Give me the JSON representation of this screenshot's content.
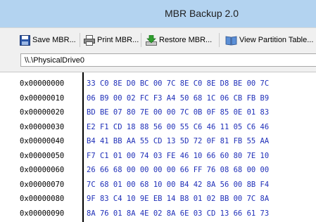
{
  "window": {
    "title": "MBR Backup 2.0"
  },
  "toolbar": {
    "save_label": "Save MBR...",
    "print_label": "Print MBR...",
    "restore_label": "Restore MBR...",
    "partition_label": "View Partition Table..."
  },
  "drive": {
    "selected": "\\\\.\\PhysicalDrive0"
  },
  "hex": {
    "rows": [
      {
        "offset": "0x00000000",
        "bytes": "33 C0 8E D0 BC 00 7C 8E C0 8E D8 BE 00 7C"
      },
      {
        "offset": "0x00000010",
        "bytes": "06 B9 00 02 FC F3 A4 50 68 1C 06 CB FB B9"
      },
      {
        "offset": "0x00000020",
        "bytes": "BD BE 07 80 7E 00 00 7C 0B 0F 85 0E 01 83"
      },
      {
        "offset": "0x00000030",
        "bytes": "E2 F1 CD 18 88 56 00 55 C6 46 11 05 C6 46"
      },
      {
        "offset": "0x00000040",
        "bytes": "B4 41 BB AA 55 CD 13 5D 72 0F 81 FB 55 AA"
      },
      {
        "offset": "0x00000050",
        "bytes": "F7 C1 01 00 74 03 FE 46 10 66 60 80 7E 10"
      },
      {
        "offset": "0x00000060",
        "bytes": "26 66 68 00 00 00 00 66 FF 76 08 68 00 00"
      },
      {
        "offset": "0x00000070",
        "bytes": "7C 68 01 00 68 10 00 B4 42 8A 56 00 8B F4"
      },
      {
        "offset": "0x00000080",
        "bytes": "9F 83 C4 10 9E EB 14 B8 01 02 BB 00 7C 8A"
      },
      {
        "offset": "0x00000090",
        "bytes": "8A 76 01 8A 4E 02 8A 6E 03 CD 13 66 61 73"
      }
    ]
  }
}
